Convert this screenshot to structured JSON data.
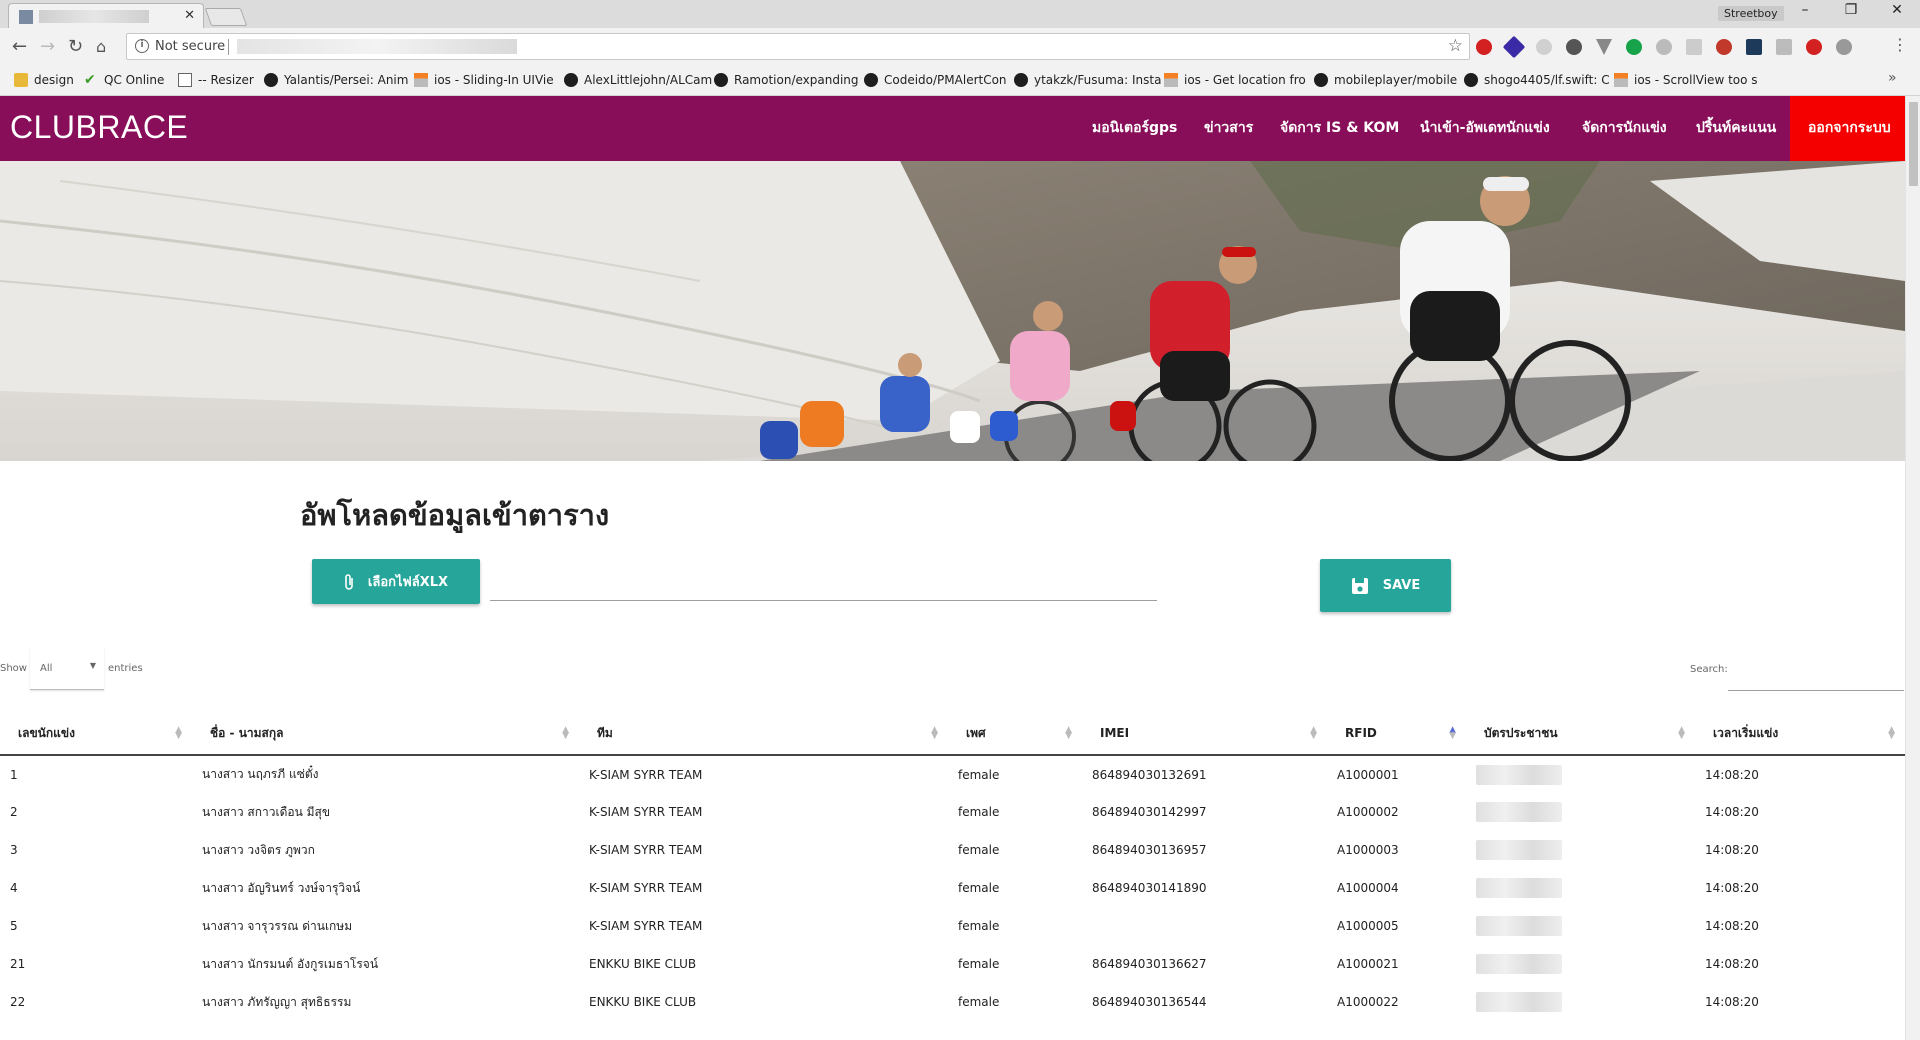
{
  "browser": {
    "window_user": "Streetboy",
    "security_label": "Not secure",
    "bookmarks": [
      {
        "label": "design",
        "icon": "folder-icon"
      },
      {
        "label": "QC Online",
        "icon": "check-icon"
      },
      {
        "label": "-- Resizer",
        "icon": "page-icon"
      },
      {
        "label": "Yalantis/Persei: Anim",
        "icon": "github-icon"
      },
      {
        "label": "ios - Sliding-In UIVie",
        "icon": "stackoverflow-icon"
      },
      {
        "label": "AlexLittlejohn/ALCam",
        "icon": "github-icon"
      },
      {
        "label": "Ramotion/expanding",
        "icon": "github-icon"
      },
      {
        "label": "Codeido/PMAlertCon",
        "icon": "github-icon"
      },
      {
        "label": "ytakzk/Fusuma: Insta",
        "icon": "github-icon"
      },
      {
        "label": "ios - Get location fro",
        "icon": "stackoverflow-icon"
      },
      {
        "label": "mobileplayer/mobile",
        "icon": "github-icon"
      },
      {
        "label": "shogo4405/lf.swift: C",
        "icon": "github-icon"
      },
      {
        "label": "ios - ScrollView too s",
        "icon": "stackoverflow-icon"
      }
    ]
  },
  "site": {
    "brand": "CLUBRACE",
    "nav": [
      "มอนิเตอร์gps",
      "ข่าวสาร",
      "จัดการ IS & KOM",
      "นำเข้า-อัพเดทนักแข่ง",
      "จัดการนักแข่ง",
      "ปริ้นท์คะแนน"
    ],
    "logout": "ออกจากระบบ",
    "accent": "#880e5a",
    "logout_color": "#f40000",
    "button_color": "#26a69a"
  },
  "upload": {
    "title": "อัพโหลดข้อมูลเข้าตาราง",
    "choose_file_label": "เลือกไฟล์XLX",
    "save_label": "SAVE"
  },
  "table": {
    "show_label": "Show",
    "page_length": "All",
    "entries_label": "entries",
    "search_label": "Search:",
    "columns": [
      "เลขนักแข่ง",
      "ชื่อ - นามสกุล",
      "ทีม",
      "เพศ",
      "IMEI",
      "RFID",
      "บัตรประชาชน",
      "เวลาเริ่มแข่ง"
    ],
    "rows": [
      {
        "no": "1",
        "name": "นางสาว นฤภรภี แซ่ตั๋ง",
        "team": "K-SIAM SYRR TEAM",
        "gender": "female",
        "imei": "864894030132691",
        "rfid": "A1000001",
        "time": "14:08:20"
      },
      {
        "no": "2",
        "name": "นางสาว สกาวเดือน มีสุข",
        "team": "K-SIAM SYRR TEAM",
        "gender": "female",
        "imei": "864894030142997",
        "rfid": "A1000002",
        "time": "14:08:20"
      },
      {
        "no": "3",
        "name": "นางสาว วงจิตร ภูพวก",
        "team": "K-SIAM SYRR TEAM",
        "gender": "female",
        "imei": "864894030136957",
        "rfid": "A1000003",
        "time": "14:08:20"
      },
      {
        "no": "4",
        "name": "นางสาว อัญรินทร์ วงษ์จารุวิจน์",
        "team": "K-SIAM SYRR TEAM",
        "gender": "female",
        "imei": "864894030141890",
        "rfid": "A1000004",
        "time": "14:08:20"
      },
      {
        "no": "5",
        "name": "นางสาว จารุวรรณ ด่านเกษม",
        "team": "K-SIAM SYRR TEAM",
        "gender": "female",
        "imei": "",
        "rfid": "A1000005",
        "time": "14:08:20"
      },
      {
        "no": "21",
        "name": "นางสาว นักรมนต์ อังกูรเมธาโรจน์",
        "team": "ENKKU BIKE CLUB",
        "gender": "female",
        "imei": "864894030136627",
        "rfid": "A1000021",
        "time": "14:08:20"
      },
      {
        "no": "22",
        "name": "นางสาว ภัทรัญญา สุทธิธรรม",
        "team": "ENKKU BIKE CLUB",
        "gender": "female",
        "imei": "864894030136544",
        "rfid": "A1000022",
        "time": "14:08:20"
      }
    ]
  }
}
